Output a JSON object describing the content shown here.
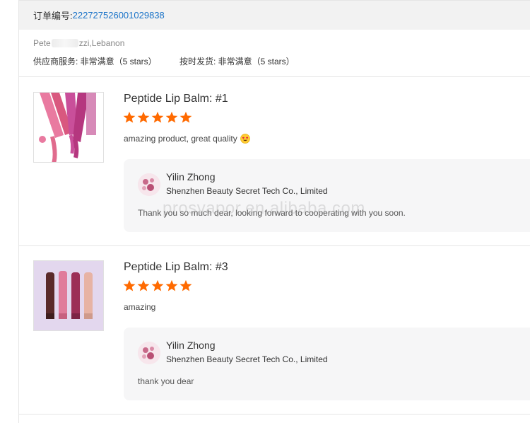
{
  "order": {
    "label": "订单编号:",
    "number": "222727526001029838"
  },
  "buyer": {
    "name_start": "Pete",
    "name_end": "zzi,Lebanon"
  },
  "supplier_ratings": [
    {
      "label": "供应商服务: 非常满意（5 stars）",
      "stars": 5
    },
    {
      "label": "按时发货: 非常满意（5 stars）",
      "stars": 5
    }
  ],
  "reviews": [
    {
      "product_title": "Peptide Lip Balm: #1",
      "rating": 5,
      "text": "amazing product, great quality",
      "emoji": "heart-eyes-emoji",
      "reply": {
        "name": "Yilin Zhong",
        "company": "Shenzhen Beauty Secret Tech Co., Limited",
        "text": "Thank you so much dear, looking forward to cooperating with you soon."
      }
    },
    {
      "product_title": "Peptide Lip Balm: #3",
      "rating": 5,
      "text": "amazing",
      "reply": {
        "name": "Yilin Zhong",
        "company": "Shenzhen Beauty Secret Tech Co., Limited",
        "text": "thank you dear"
      }
    }
  ],
  "watermark": "prosvapor.en.alibaba.com",
  "colors": {
    "star": "#ff6a00",
    "link": "#1a73c8",
    "header_bg": "#f2f2f2",
    "reply_bg": "#f6f6f7"
  }
}
